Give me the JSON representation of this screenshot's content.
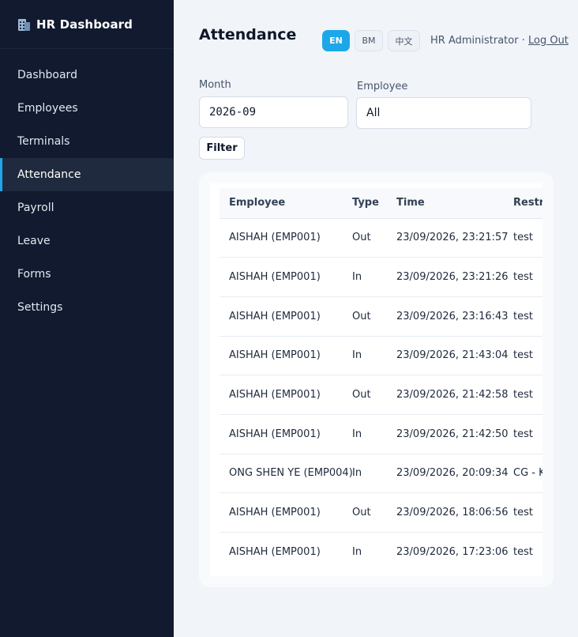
{
  "brand": {
    "title": "HR Dashboard",
    "icon": "office-building-icon"
  },
  "sidebar": {
    "items": [
      {
        "label": "Dashboard",
        "active": false
      },
      {
        "label": "Employees",
        "active": false
      },
      {
        "label": "Terminals",
        "active": false
      },
      {
        "label": "Attendance",
        "active": true
      },
      {
        "label": "Payroll",
        "active": false
      },
      {
        "label": "Leave",
        "active": false
      },
      {
        "label": "Forms",
        "active": false
      },
      {
        "label": "Settings",
        "active": false
      }
    ]
  },
  "header": {
    "title": "Attendance",
    "languages": [
      "EN",
      "BM",
      "中文"
    ],
    "active_language": "EN",
    "user": "HR Administrator",
    "separator": "·",
    "logout": "Log Out"
  },
  "filters": {
    "month_label": "Month",
    "month_value": "2026-09",
    "employee_label": "Employee",
    "employee_value": "All",
    "filter_button": "Filter"
  },
  "table": {
    "columns": [
      "Employee",
      "Type",
      "Time",
      "Restricted Terminal"
    ],
    "rows": [
      [
        "AISHAH (EMP001)",
        "Out",
        "23/09/2026, 23:21:57",
        "test"
      ],
      [
        "AISHAH (EMP001)",
        "In",
        "23/09/2026, 23:21:26",
        "test"
      ],
      [
        "AISHAH (EMP001)",
        "Out",
        "23/09/2026, 23:16:43",
        "test"
      ],
      [
        "AISHAH (EMP001)",
        "In",
        "23/09/2026, 21:43:04",
        "test"
      ],
      [
        "AISHAH (EMP001)",
        "Out",
        "23/09/2026, 21:42:58",
        "test"
      ],
      [
        "AISHAH (EMP001)",
        "In",
        "23/09/2026, 21:42:50",
        "test"
      ],
      [
        "ONG SHEN YE (EMP004)",
        "In",
        "23/09/2026, 20:09:34",
        "CG - KUANG"
      ],
      [
        "AISHAH (EMP001)",
        "Out",
        "23/09/2026, 18:06:56",
        "test"
      ],
      [
        "AISHAH (EMP001)",
        "In",
        "23/09/2026, 17:23:06",
        "test"
      ]
    ]
  },
  "colors": {
    "sidebar_bg": "#111a2e",
    "accent": "#1ea7e8",
    "page_bg": "#f1f4f9"
  }
}
